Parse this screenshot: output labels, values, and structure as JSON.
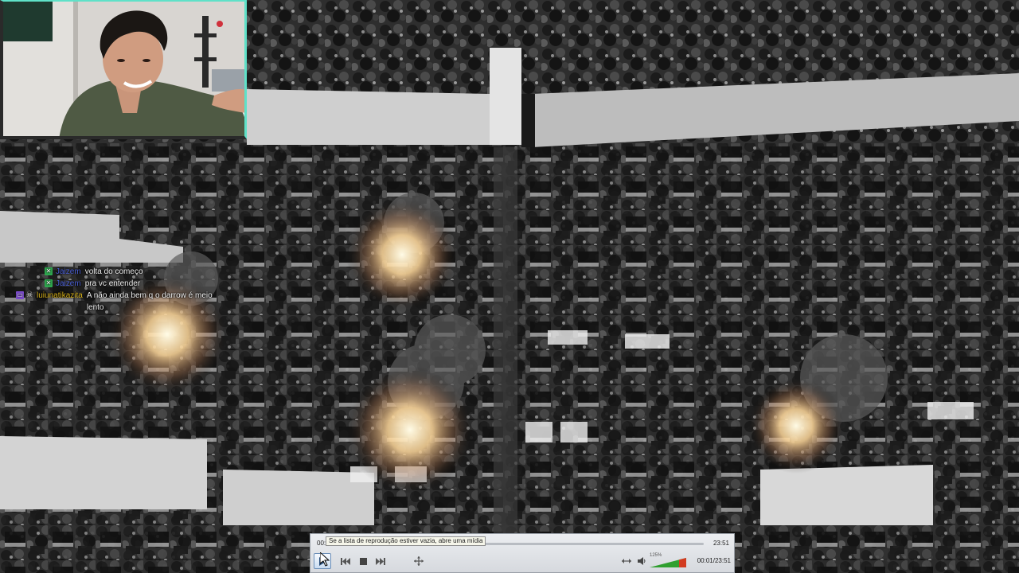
{
  "chat": {
    "messages": [
      {
        "user": "Jaizem",
        "user_color": "#4a5fd6",
        "text": "volta do começo",
        "badges": [
          "green-badge"
        ]
      },
      {
        "user": "Jaizem",
        "user_color": "#4a5fd6",
        "text": "pra vc entender",
        "badges": [
          "green-badge"
        ]
      },
      {
        "user": "luiunatikazita",
        "user_color": "#d7b11a",
        "text": "A não ainda bem q o darrow é meio lento",
        "badges": [
          "purple-badge",
          "skull-badge"
        ]
      }
    ]
  },
  "player": {
    "time_elapsed": "00:01",
    "time_duration": "23:51",
    "tooltip": "Se a lista de reprodução estiver vazia, abre uma mídia",
    "volume_percent": "125%",
    "volume_level": 1.25,
    "time_counter": "00:01/23:51",
    "icons": {
      "play": "play-icon",
      "previous": "previous-icon",
      "stop": "stop-icon",
      "next": "next-icon",
      "fullscreen": "fullscreen-icon",
      "playlist": "playlist-icon",
      "volume": "speaker-icon"
    },
    "accent_color": "#2f9f2f"
  },
  "scene": {
    "theme": "grayscale aerial view of a city with glowing fires"
  }
}
